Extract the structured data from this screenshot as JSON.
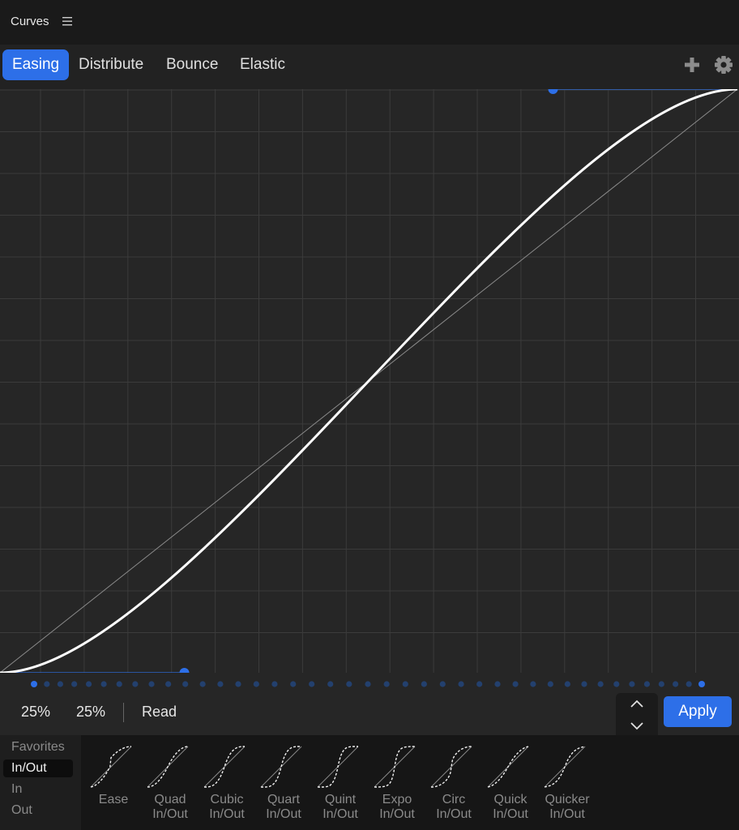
{
  "app": {
    "title": "Curves"
  },
  "tabs": [
    {
      "label": "Easing",
      "active": true
    },
    {
      "label": "Distribute",
      "active": false
    },
    {
      "label": "Bounce",
      "active": false
    },
    {
      "label": "Elastic",
      "active": false
    }
  ],
  "curve": {
    "type": "cubic-bezier",
    "control_point_1": [
      0.25,
      0
    ],
    "control_point_2": [
      0.75,
      1
    ],
    "accent_color": "#2d6fe8"
  },
  "controls": {
    "value_1": "25%",
    "value_2": "25%",
    "read_label": "Read",
    "apply_label": "Apply"
  },
  "sidebar": {
    "items": [
      {
        "label": "Favorites",
        "active": false
      },
      {
        "label": "In/Out",
        "active": true
      },
      {
        "label": "In",
        "active": false
      },
      {
        "label": "Out",
        "active": false
      }
    ]
  },
  "presets": [
    {
      "line1": "Ease",
      "line2": ""
    },
    {
      "line1": "Quad",
      "line2": "In/Out"
    },
    {
      "line1": "Cubic",
      "line2": "In/Out"
    },
    {
      "line1": "Quart",
      "line2": "In/Out"
    },
    {
      "line1": "Quint",
      "line2": "In/Out"
    },
    {
      "line1": "Expo",
      "line2": "In/Out"
    },
    {
      "line1": "Circ",
      "line2": "In/Out"
    },
    {
      "line1": "Quick",
      "line2": "In/Out"
    },
    {
      "line1": "Quicker",
      "line2": "In/Out"
    }
  ],
  "icons": [
    "menu-icon",
    "plus-icon",
    "gear-icon",
    "chevron-up-icon",
    "chevron-down-icon"
  ]
}
